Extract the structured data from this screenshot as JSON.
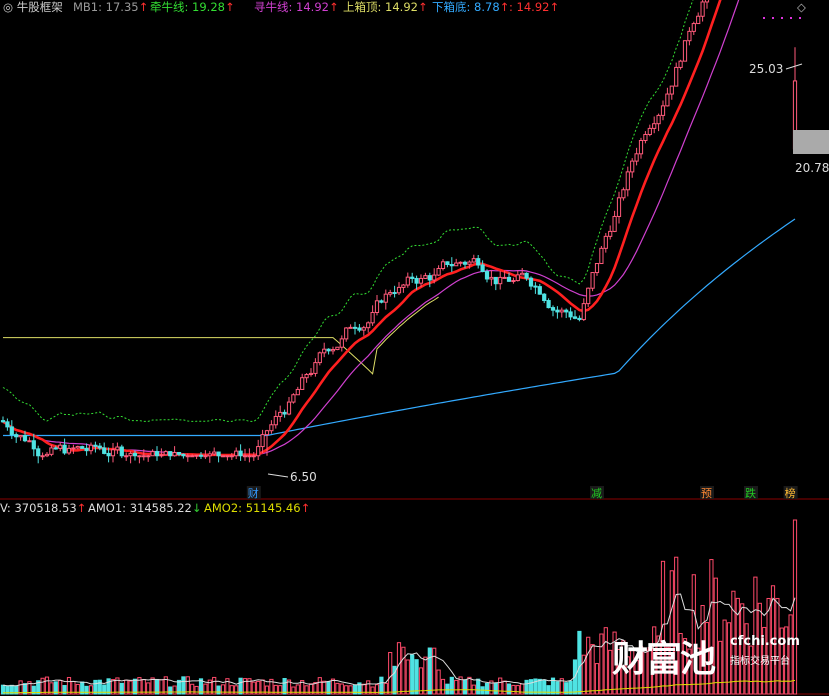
{
  "header": {
    "indicator_name": "牛股框架",
    "items": [
      {
        "label": "MB1: 17.35",
        "color": "#9a9a9a",
        "arrow": "↑"
      },
      {
        "label": "牵牛线: 19.28",
        "color": "#33dd33",
        "arrow": "↑"
      },
      {
        "label": "寻牛线: 14.92",
        "color": "#d040d0",
        "arrow": "↑"
      },
      {
        "label": "上箱顶: 14.92",
        "color": "#dddd66",
        "arrow": "↑"
      },
      {
        "label": "下箱底: 8.78",
        "color": "#33aaff",
        "arrow": "↑"
      },
      {
        "label": ": 14.92",
        "color": "#ff3030",
        "arrow": "↑"
      }
    ],
    "diamond_icon": "diamond-outline-icon"
  },
  "volume_header": {
    "items": [
      {
        "label": "V: 370518.53",
        "color": "#dddddd",
        "arrow": "↑"
      },
      {
        "label": "AMO1: 314585.22",
        "color": "#dddddd",
        "arrow": "↓"
      },
      {
        "label": "AMO2: 51145.46",
        "color": "#dddd00",
        "arrow": "↑"
      }
    ]
  },
  "chart_data": [
    {
      "type": "candlestick",
      "annotations": {
        "high_label": "25.03",
        "low_label": "6.50",
        "right_box_label": "20.78",
        "signals": [
          {
            "text": "财",
            "bar": 57,
            "color": "#3399ff"
          },
          {
            "text": "减",
            "bar": 135,
            "color": "#22cc22"
          },
          {
            "text": "预",
            "bar": 160,
            "color": "#ff8833"
          },
          {
            "text": "跌",
            "bar": 170,
            "color": "#22cc22"
          },
          {
            "text": "榜",
            "bar": 179,
            "color": "#ffbb33"
          }
        ]
      },
      "series": [
        {
          "name": "牵牛线",
          "color": "#33dd33",
          "style": "dashed"
        },
        {
          "name": "寻牛线",
          "color": "#d040d0"
        },
        {
          "name": "上箱顶",
          "color": "#dddd66"
        },
        {
          "name": "下箱底",
          "color": "#33aaff"
        },
        {
          "name": "red-line",
          "color": "#ff2020"
        }
      ],
      "ohlc": []
    },
    {
      "type": "bar",
      "volumes": [],
      "series": [
        {
          "name": "AMO1",
          "color": "#dddddd"
        },
        {
          "name": "AMO2",
          "color": "#dddd00"
        }
      ]
    }
  ],
  "watermark": {
    "main": "财富池",
    "site": "cfchi.com",
    "sub": "指标交易平台"
  }
}
